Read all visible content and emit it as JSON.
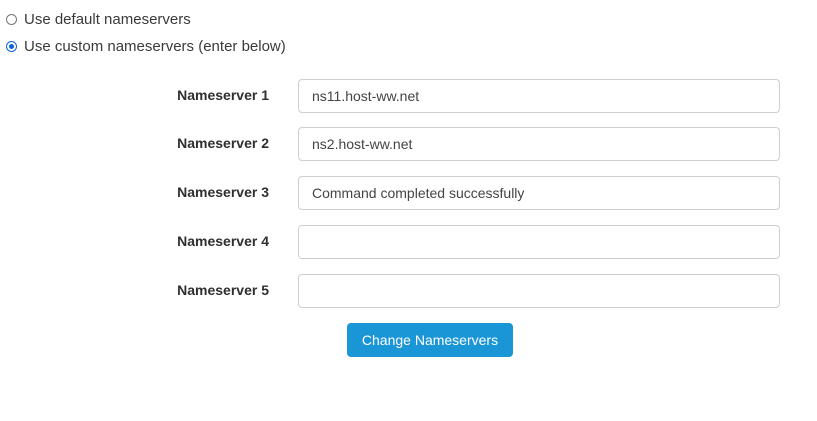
{
  "mode": {
    "default_label": "Use default nameservers",
    "custom_label": "Use custom nameservers (enter below)",
    "selected": "custom"
  },
  "nameservers": [
    {
      "label": "Nameserver 1",
      "value": "ns11.host-ww.net"
    },
    {
      "label": "Nameserver 2",
      "value": "ns2.host-ww.net"
    },
    {
      "label": "Nameserver 3",
      "value": "Command completed successfully"
    },
    {
      "label": "Nameserver 4",
      "value": ""
    },
    {
      "label": "Nameserver 5",
      "value": ""
    }
  ],
  "submit_label": "Change Nameservers",
  "colors": {
    "accent": "#1a96d7",
    "radio_checked": "#0a64d6"
  }
}
